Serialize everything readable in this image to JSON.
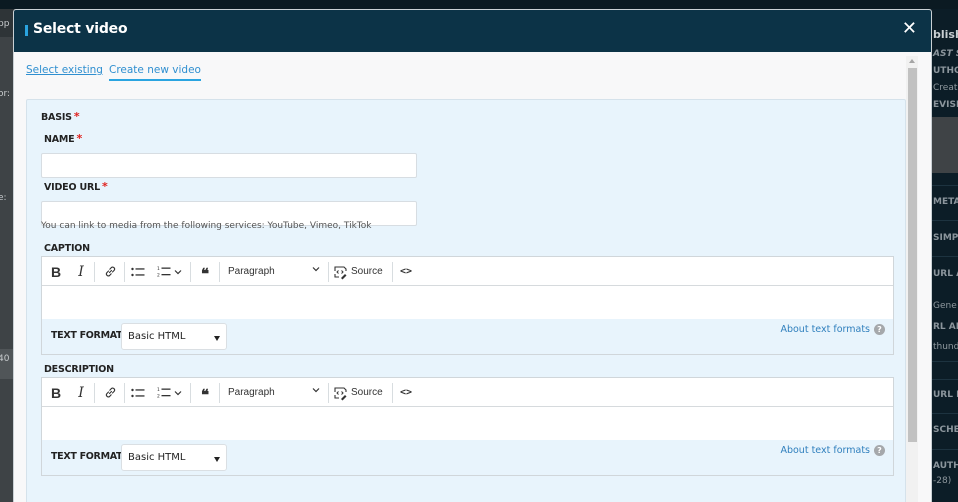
{
  "background": {
    "left_fragments": [
      "pp",
      "or:",
      "e:",
      "40"
    ],
    "right_fragments": [
      "blish",
      "AST SA",
      "UTHOR",
      "Creat",
      "EVISIO",
      "META",
      "SIMPL",
      "URL A",
      "Gene",
      "RL ALIA",
      "thunde",
      "URL R",
      "SCHE",
      "AUTH",
      "-28)"
    ]
  },
  "modal": {
    "title": "Select video",
    "close_icon": "✕",
    "tabs": [
      {
        "label": "Select existing",
        "active": false
      },
      {
        "label": "Create new video",
        "active": true
      }
    ],
    "form": {
      "legend": "BASIS",
      "required_mark": "*",
      "name": {
        "label": "NAME",
        "value": "",
        "placeholder": ""
      },
      "video_url": {
        "label": "VIDEO URL",
        "value": "",
        "placeholder": ""
      },
      "video_url_help": "You can link to media from the following services: YouTube, Vimeo, TikTok",
      "caption": {
        "label": "CAPTION",
        "toolbar": {
          "bold": "B",
          "italic": "I",
          "link_icon": "link-icon",
          "bulleted_list_icon": "bulleted-list-icon",
          "numbered_list_icon": "numbered-list-icon",
          "quote": "❝",
          "heading_select": "Paragraph",
          "source": "Source",
          "code": "<>"
        },
        "value": "",
        "text_format_label": "TEXT FORMAT",
        "text_format_value": "Basic HTML",
        "about_link": "About text formats",
        "help_icon": "?"
      },
      "description": {
        "label": "DESCRIPTION",
        "toolbar": {
          "bold": "B",
          "italic": "I",
          "link_icon": "link-icon",
          "bulleted_list_icon": "bulleted-list-icon",
          "numbered_list_icon": "numbered-list-icon",
          "quote": "❝",
          "heading_select": "Paragraph",
          "source": "Source",
          "code": "<>"
        },
        "value": "",
        "text_format_label": "TEXT FORMAT",
        "text_format_value": "Basic HTML",
        "about_link": "About text formats",
        "help_icon": "?"
      }
    }
  }
}
